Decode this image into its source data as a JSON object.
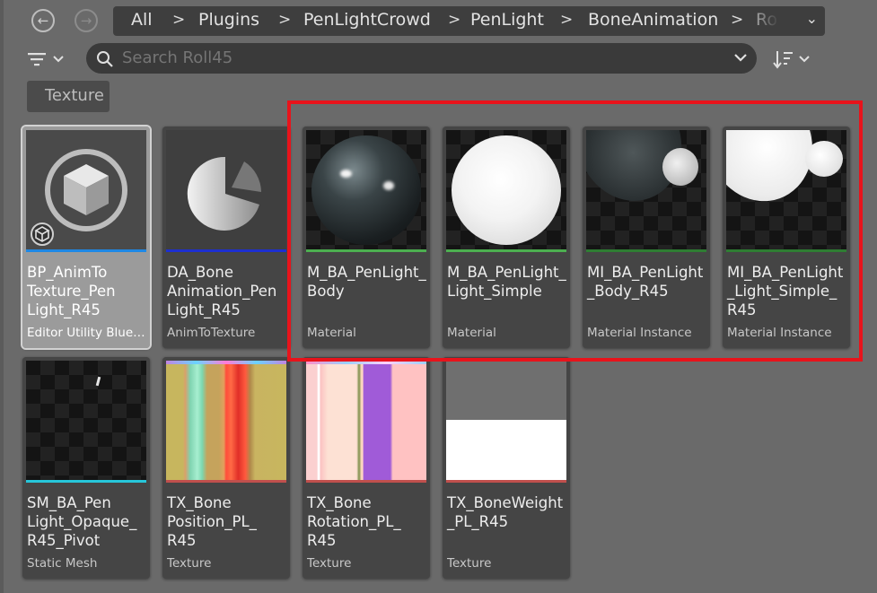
{
  "nav": {
    "back_icon": "arrow-left-circle-icon",
    "forward_icon": "arrow-right-circle-icon"
  },
  "breadcrumb": {
    "items": [
      "All",
      "Plugins",
      "PenLightCrowd",
      "PenLight",
      "BoneAnimation",
      "Ro"
    ],
    "separator": ">",
    "dropdown_icon": "chevron-down-icon"
  },
  "toolbar": {
    "filter_icon": "filter-lines-icon",
    "sort_icon": "sort-icon"
  },
  "search": {
    "placeholder": "Search Roll45",
    "icon": "search-icon"
  },
  "filter_chips": [
    "Texture"
  ],
  "assets": [
    {
      "name": "BP_AnimTo\nTexture_Pen\nLight_R45",
      "type": "Editor Utility Bluep...",
      "type_color": "#1e88e5",
      "thumb": "editor-utility-cube-icon",
      "selected": true
    },
    {
      "name": "DA_Bone\nAnimation_Pen\nLight_R45",
      "type": "AnimToTexture",
      "type_color": "#1d2fd0",
      "thumb": "data-asset-pie-icon",
      "selected": false
    },
    {
      "name": "M_BA_PenLight_\nBody",
      "type": "Material",
      "type_color": "#4caf50",
      "thumb": "dark-sphere",
      "selected": false
    },
    {
      "name": "M_BA_PenLight_\nLight_Simple",
      "type": "Material",
      "type_color": "#4caf50",
      "thumb": "white-sphere",
      "selected": false
    },
    {
      "name": "MI_BA_PenLight\n_Body_R45",
      "type": "Material Instance",
      "type_color": "#2e7d32",
      "thumb": "dark-penlight",
      "selected": false
    },
    {
      "name": "MI_BA_PenLight\n_Light_Simple_\nR45",
      "type": "Material Instance",
      "type_color": "#2e7d32",
      "thumb": "white-penlight",
      "selected": false
    },
    {
      "name": "SM_BA_Pen\nLight_Opaque_\nR45_Pivot",
      "type": "Static Mesh",
      "type_color": "#26c6da",
      "thumb": "static-mesh",
      "selected": false
    },
    {
      "name": "TX_Bone\nPosition_PL_\nR45",
      "type": "Texture",
      "type_color": "#c0504d",
      "thumb": "position-texture",
      "selected": false
    },
    {
      "name": "TX_Bone\nRotation_PL_\nR45",
      "type": "Texture",
      "type_color": "#c0504d",
      "thumb": "rotation-texture",
      "selected": false
    },
    {
      "name": "TX_BoneWeight\n_PL_R45",
      "type": "Texture",
      "type_color": "#c0504d",
      "thumb": "weight-texture",
      "selected": false
    }
  ],
  "highlight_color": "#e8131b"
}
